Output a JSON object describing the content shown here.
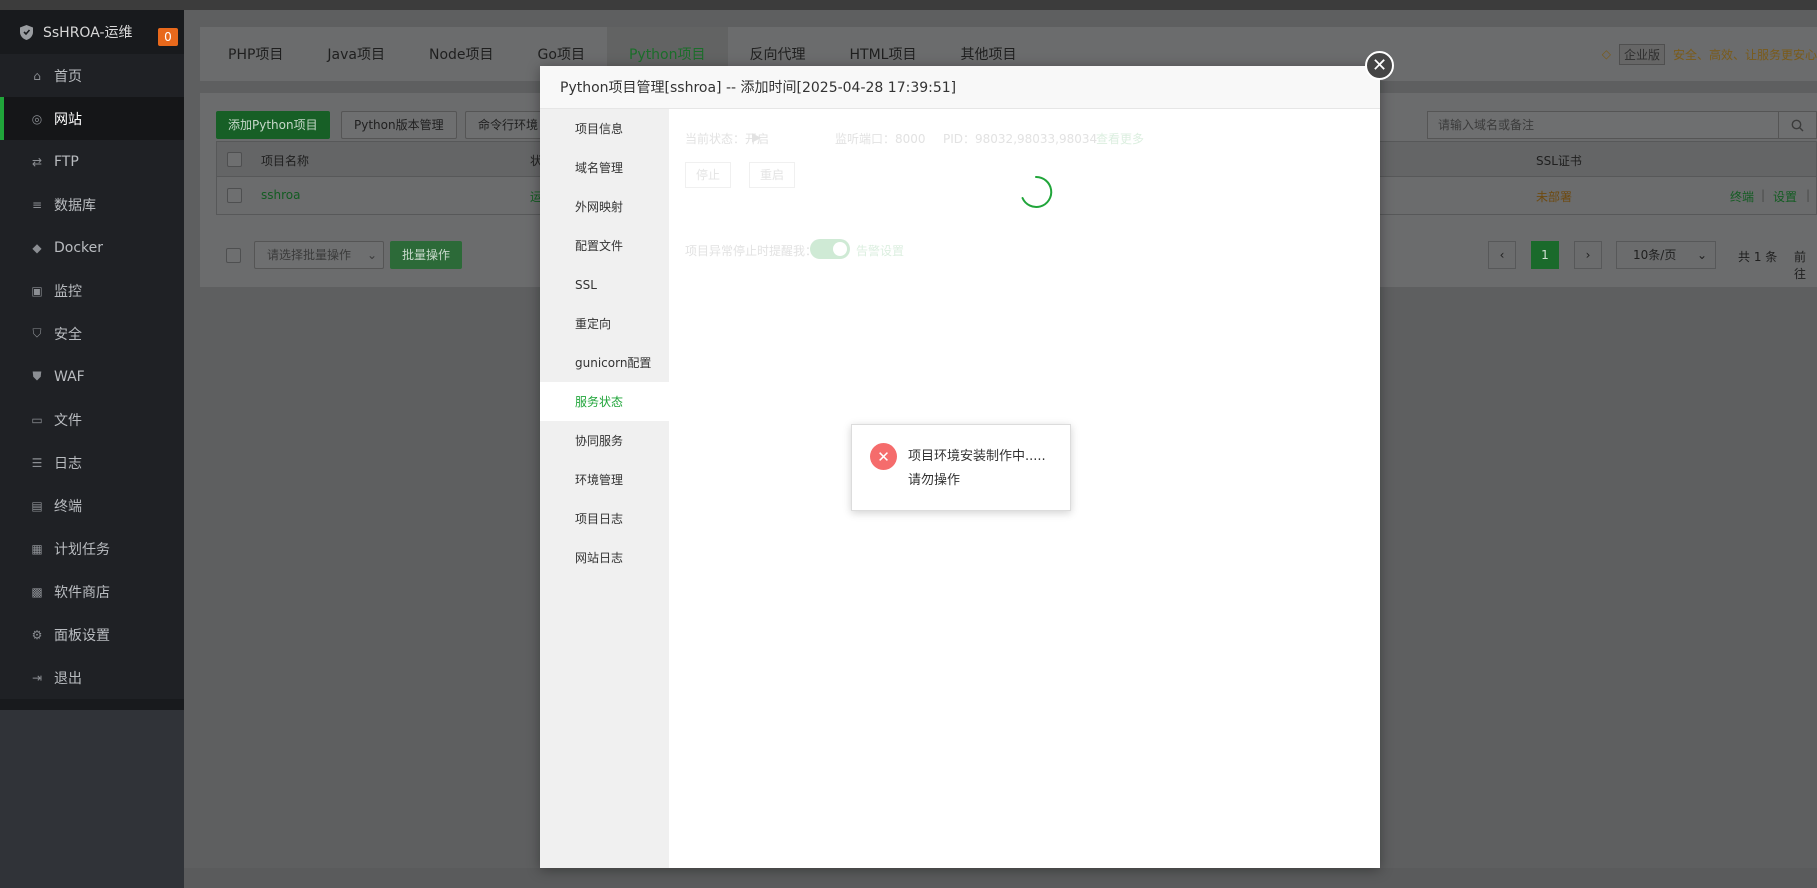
{
  "app": {
    "brand": "SsHROA-运维",
    "badge_count": "0"
  },
  "sidebar": {
    "items": [
      {
        "label": "首页",
        "icon": "home-icon"
      },
      {
        "label": "网站",
        "icon": "globe-icon",
        "active": true
      },
      {
        "label": "FTP",
        "icon": "ftp-icon"
      },
      {
        "label": "数据库",
        "icon": "database-icon"
      },
      {
        "label": "Docker",
        "icon": "docker-icon"
      },
      {
        "label": "监控",
        "icon": "monitor-icon"
      },
      {
        "label": "安全",
        "icon": "shield-icon"
      },
      {
        "label": "WAF",
        "icon": "waf-icon"
      },
      {
        "label": "文件",
        "icon": "folder-icon"
      },
      {
        "label": "日志",
        "icon": "log-icon"
      },
      {
        "label": "终端",
        "icon": "terminal-icon"
      },
      {
        "label": "计划任务",
        "icon": "calendar-icon"
      },
      {
        "label": "软件商店",
        "icon": "store-icon"
      },
      {
        "label": "面板设置",
        "icon": "gear-icon"
      },
      {
        "label": "退出",
        "icon": "logout-icon"
      }
    ]
  },
  "tabs": [
    "PHP项目",
    "Java项目",
    "Node项目",
    "Go项目",
    "Python项目",
    "反向代理",
    "HTML项目",
    "其他项目"
  ],
  "promo": {
    "vip_label": "企业版",
    "slogan": "安全、高效、让服务更安心"
  },
  "toolbar": {
    "add_python": "添加Python项目",
    "python_version": "Python版本管理",
    "cli_env": "命令行环境",
    "search_placeholder": "请输入域名或备注"
  },
  "table": {
    "col_name": "项目名称",
    "col_status_partial": "状",
    "col_ssl": "SSL证书",
    "row": {
      "name": "sshroa",
      "status_partial": "运",
      "ssl": "未部署",
      "action_terminal": "终端",
      "action_settings": "设置",
      "action_more_partial": "|"
    }
  },
  "footer": {
    "batch_placeholder": "请选择批量操作",
    "batch_button": "批量操作",
    "page": "1",
    "page_size": "10条/页",
    "total": "共 1 条",
    "goto": "前往"
  },
  "modal": {
    "title": "Python项目管理[sshroa] -- 添加时间[2025-04-28 17:39:51]",
    "nav": [
      {
        "label": "项目信息"
      },
      {
        "label": "域名管理"
      },
      {
        "label": "外网映射"
      },
      {
        "label": "配置文件"
      },
      {
        "label": "SSL"
      },
      {
        "label": "重定向"
      },
      {
        "label": "gunicorn配置"
      },
      {
        "label": "服务状态",
        "active": true
      },
      {
        "label": "协同服务"
      },
      {
        "label": "环境管理"
      },
      {
        "label": "项目日志"
      },
      {
        "label": "网站日志"
      }
    ],
    "status_line": {
      "status": "当前状态：开启",
      "port": "监听端口：8000",
      "pid": "PID：98032,98033,98034",
      "more": "查看更多"
    },
    "buttons": {
      "stop": "停止",
      "restart": "重启"
    },
    "alert": {
      "label": "项目异常停止时提醒我：",
      "link": "告警设置"
    }
  },
  "toast": {
    "message": "项目环境安装制作中.....请勿操作",
    "type": "error"
  },
  "colors": {
    "accent": "#20a53a",
    "error": "#f56c6c",
    "warning": "#e6a23c"
  }
}
